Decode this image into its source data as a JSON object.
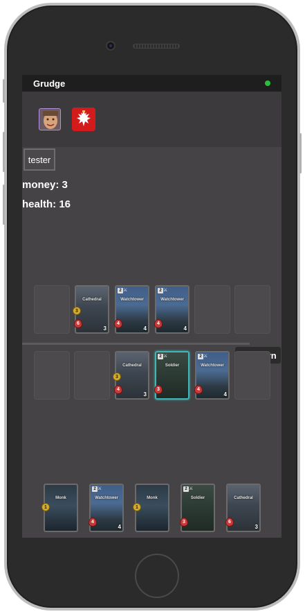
{
  "app": {
    "title": "Grudge",
    "status_color": "#2ebd3a"
  },
  "opponent": {
    "avatar_icon": "face-avatar-icon",
    "emblem_icon": "polish-eagle-emblem-icon"
  },
  "player": {
    "name": "tester",
    "money_label": "money: 3",
    "health_label": "health: 16"
  },
  "actions": {
    "end_turn_label": "End turn"
  },
  "board": {
    "opponent_row": [
      null,
      {
        "name": "Cathedral",
        "money": "3",
        "health": "6",
        "attack": "3",
        "art": "cathedral"
      },
      {
        "name": "Watchtower",
        "cost": "2",
        "health": "4",
        "attack": "4",
        "art": "watchtower"
      },
      {
        "name": "Watchtower",
        "cost": "2",
        "health": "4",
        "attack": "4",
        "art": "watchtower"
      },
      null,
      null
    ],
    "player_row": [
      null,
      null,
      {
        "name": "Cathedral",
        "money": "3",
        "health": "4",
        "attack": "3",
        "art": "cathedral"
      },
      {
        "name": "Soldier",
        "cost": "2",
        "health": "3",
        "attack": "",
        "art": "soldier",
        "selected": true
      },
      {
        "name": "Watchtower",
        "cost": "2",
        "health": "4",
        "attack": "4",
        "art": "watchtower"
      },
      null
    ]
  },
  "hand": [
    {
      "name": "Monk",
      "money": "1",
      "art": "monk"
    },
    {
      "name": "Watchtower",
      "cost": "2",
      "health": "4",
      "attack": "4",
      "art": "watchtower"
    },
    {
      "name": "Monk",
      "money": "1",
      "art": "monk"
    },
    {
      "name": "Soldier",
      "cost": "2",
      "health": "3",
      "attack": "",
      "art": "soldier"
    },
    {
      "name": "Cathedral",
      "health": "6",
      "attack": "3",
      "art": "cathedral"
    }
  ]
}
